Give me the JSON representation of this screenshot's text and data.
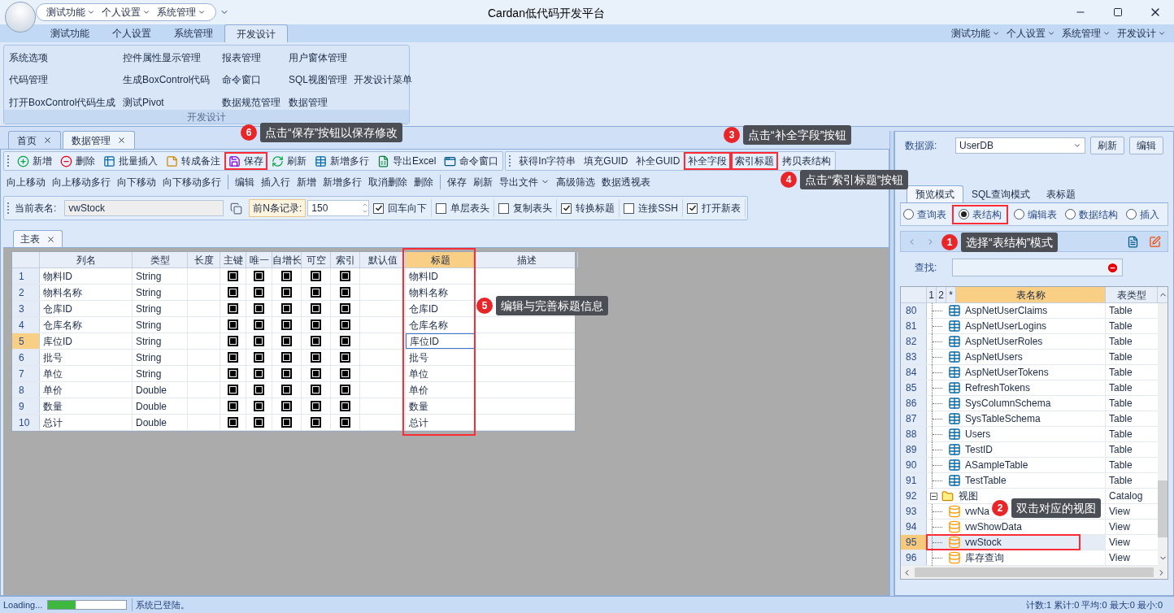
{
  "window": {
    "title": "Cardan低代码开发平台"
  },
  "quick_access": [
    "测试功能",
    "个人设置",
    "系统管理"
  ],
  "ribbon_tabs": [
    {
      "label": "测试功能",
      "selected": false
    },
    {
      "label": "个人设置",
      "selected": false
    },
    {
      "label": "系统管理",
      "selected": false
    },
    {
      "label": "开发设计",
      "selected": true
    }
  ],
  "header_menus": [
    "测试功能",
    "个人设置",
    "系统管理",
    "开发设计"
  ],
  "ribbon_group": {
    "title": "开发设计",
    "rows": [
      [
        "系统选项",
        "控件属性显示管理",
        "报表管理",
        "用户窗体管理"
      ],
      [
        "代码管理",
        "生成BoxControl代码",
        "命令窗口",
        "SQL视图管理",
        "开发设计菜单"
      ],
      [
        "打开BoxControl代码生成",
        "测试Pivot",
        "数据规范管理",
        "数据管理"
      ]
    ]
  },
  "document_tabs": [
    {
      "label": "首页",
      "selected": false
    },
    {
      "label": "数据管理",
      "selected": true
    }
  ],
  "toolbar_1": [
    [
      {
        "label": "新增",
        "kind": "add",
        "highlighted": false
      },
      {
        "label": "删除",
        "kind": "delete",
        "highlighted": false
      },
      {
        "label": "批量插入",
        "kind": "batch",
        "highlighted": false
      },
      {
        "label": "转成备注",
        "kind": "note",
        "highlighted": false
      },
      {
        "label": "保存",
        "kind": "save",
        "highlighted": true
      },
      {
        "label": "刷新",
        "kind": "refresh",
        "highlighted": false
      },
      {
        "label": "新增多行",
        "kind": "addrows",
        "highlighted": false
      },
      {
        "label": "导出Excel",
        "kind": "excel",
        "highlighted": false
      },
      {
        "label": "命令窗口",
        "kind": "window",
        "highlighted": false
      }
    ],
    [
      {
        "label": "获得In字符串",
        "kind": "text",
        "highlighted": false
      },
      {
        "label": "填充GUID",
        "kind": "text",
        "highlighted": false
      },
      {
        "label": "补全GUID",
        "kind": "text",
        "highlighted": false
      },
      {
        "label": "补全字段",
        "kind": "text",
        "highlighted": true
      },
      {
        "label": "索引标题",
        "kind": "text",
        "highlighted": true
      },
      {
        "label": "拷贝表结构",
        "kind": "text",
        "highlighted": false
      }
    ]
  ],
  "toolbar_2": [
    [
      {
        "label": "向上移动",
        "dropdown": false
      },
      {
        "label": "向上移动多行",
        "dropdown": false
      },
      {
        "label": "向下移动",
        "dropdown": false
      },
      {
        "label": "向下移动多行",
        "dropdown": false
      }
    ],
    [
      {
        "label": "编辑",
        "dropdown": false
      },
      {
        "label": "插入行",
        "dropdown": false
      },
      {
        "label": "新增",
        "dropdown": false
      },
      {
        "label": "新增多行",
        "dropdown": false
      },
      {
        "label": "取消删除",
        "dropdown": false
      },
      {
        "label": "删除",
        "dropdown": false
      }
    ],
    [
      {
        "label": "保存",
        "dropdown": false
      },
      {
        "label": "刷新",
        "dropdown": false
      },
      {
        "label": "导出文件",
        "dropdown": true
      },
      {
        "label": "高级筛选",
        "dropdown": false
      },
      {
        "label": "数据透视表",
        "dropdown": false
      }
    ]
  ],
  "table_bar": {
    "label": "当前表名:",
    "value": "vwStock",
    "top_n_label": "前N条记录:",
    "top_n": "150",
    "options": [
      {
        "label": "回车向下",
        "checked": true
      },
      {
        "label": "单层表头",
        "checked": false
      },
      {
        "label": "复制表头",
        "checked": false
      },
      {
        "label": "转换标题",
        "checked": true
      },
      {
        "label": "连接SSH",
        "checked": false
      },
      {
        "label": "打开新表",
        "checked": true
      }
    ]
  },
  "sub_tabs": [
    {
      "label": "主表",
      "selected": true
    }
  ],
  "grid": {
    "columns": [
      {
        "label": "列名",
        "selected": false,
        "highlighted": false
      },
      {
        "label": "类型",
        "selected": false,
        "highlighted": false
      },
      {
        "label": "长度",
        "selected": false,
        "highlighted": false
      },
      {
        "label": "主键",
        "selected": false,
        "highlighted": false
      },
      {
        "label": "唯一",
        "selected": false,
        "highlighted": false
      },
      {
        "label": "自增长",
        "selected": false,
        "highlighted": false
      },
      {
        "label": "可空",
        "selected": false,
        "highlighted": false
      },
      {
        "label": "索引",
        "selected": false,
        "highlighted": false
      },
      {
        "label": "默认值",
        "selected": false,
        "highlighted": false
      },
      {
        "label": "标题",
        "selected": true,
        "highlighted": true
      },
      {
        "label": "描述",
        "selected": false,
        "highlighted": false
      }
    ],
    "rows": [
      {
        "num": "1",
        "name": "物料ID",
        "type": "String",
        "flags": [
          true,
          true,
          true,
          true,
          true
        ],
        "title": "物料ID",
        "selected": false
      },
      {
        "num": "2",
        "name": "物料名称",
        "type": "String",
        "flags": [
          true,
          true,
          true,
          true,
          true
        ],
        "title": "物料名称",
        "selected": false
      },
      {
        "num": "3",
        "name": "仓库ID",
        "type": "String",
        "flags": [
          true,
          true,
          true,
          true,
          true
        ],
        "title": "仓库ID",
        "selected": false
      },
      {
        "num": "4",
        "name": "仓库名称",
        "type": "String",
        "flags": [
          true,
          true,
          true,
          true,
          true
        ],
        "title": "仓库名称",
        "selected": false
      },
      {
        "num": "5",
        "name": "库位ID",
        "type": "String",
        "flags": [
          true,
          true,
          true,
          true,
          true
        ],
        "title": "库位ID",
        "selected": true
      },
      {
        "num": "6",
        "name": "批号",
        "type": "String",
        "flags": [
          true,
          true,
          true,
          true,
          true
        ],
        "title": "批号",
        "selected": false
      },
      {
        "num": "7",
        "name": "单位",
        "type": "String",
        "flags": [
          true,
          true,
          true,
          true,
          true
        ],
        "title": "单位",
        "selected": false
      },
      {
        "num": "8",
        "name": "单价",
        "type": "Double",
        "flags": [
          true,
          true,
          true,
          true,
          true
        ],
        "title": "单价",
        "selected": false
      },
      {
        "num": "9",
        "name": "数量",
        "type": "Double",
        "flags": [
          true,
          true,
          true,
          true,
          true
        ],
        "title": "数量",
        "selected": false
      },
      {
        "num": "10",
        "name": "总计",
        "type": "Double",
        "flags": [
          true,
          true,
          true,
          true,
          true
        ],
        "title": "总计",
        "selected": false
      }
    ]
  },
  "right_panel": {
    "datasource_label": "数据源:",
    "datasource": "UserDB",
    "buttons": [
      "刷新",
      "编辑"
    ],
    "tabs": [
      {
        "label": "预览模式",
        "selected": true
      },
      {
        "label": "SQL查询模式",
        "selected": false
      },
      {
        "label": "表标题",
        "selected": false
      }
    ],
    "modes": [
      {
        "label": "查询表",
        "selected": false,
        "highlighted": false
      },
      {
        "label": "表结构",
        "selected": true,
        "highlighted": true
      },
      {
        "label": "编辑表",
        "selected": false,
        "highlighted": false
      },
      {
        "label": "数据结构",
        "selected": false,
        "highlighted": false
      },
      {
        "label": "插入",
        "selected": false,
        "highlighted": false
      }
    ],
    "search_label": "查找:",
    "tree": {
      "columns": [
        {
          "label": "1",
          "selected": false
        },
        {
          "label": "2",
          "selected": false
        },
        {
          "label": "*",
          "selected": false
        },
        {
          "label": "表名称",
          "selected": true
        },
        {
          "label": "表类型",
          "selected": false
        }
      ],
      "items": [
        {
          "num": "80",
          "name": "AspNetUserClaims",
          "type": "Table",
          "kind": "table",
          "selected": false,
          "highlighted": false
        },
        {
          "num": "81",
          "name": "AspNetUserLogins",
          "type": "Table",
          "kind": "table",
          "selected": false,
          "highlighted": false
        },
        {
          "num": "82",
          "name": "AspNetUserRoles",
          "type": "Table",
          "kind": "table",
          "selected": false,
          "highlighted": false
        },
        {
          "num": "83",
          "name": "AspNetUsers",
          "type": "Table",
          "kind": "table",
          "selected": false,
          "highlighted": false
        },
        {
          "num": "84",
          "name": "AspNetUserTokens",
          "type": "Table",
          "kind": "table",
          "selected": false,
          "highlighted": false
        },
        {
          "num": "85",
          "name": "RefreshTokens",
          "type": "Table",
          "kind": "table",
          "selected": false,
          "highlighted": false
        },
        {
          "num": "86",
          "name": "SysColumnSchema",
          "type": "Table",
          "kind": "table",
          "selected": false,
          "highlighted": false
        },
        {
          "num": "87",
          "name": "SysTableSchema",
          "type": "Table",
          "kind": "table",
          "selected": false,
          "highlighted": false
        },
        {
          "num": "88",
          "name": "Users",
          "type": "Table",
          "kind": "table",
          "selected": false,
          "highlighted": false
        },
        {
          "num": "89",
          "name": "TestID",
          "type": "Table",
          "kind": "table",
          "selected": false,
          "highlighted": false
        },
        {
          "num": "90",
          "name": "ASampleTable",
          "type": "Table",
          "kind": "table",
          "selected": false,
          "highlighted": false
        },
        {
          "num": "91",
          "name": "TestTable",
          "type": "Table",
          "kind": "table",
          "selected": false,
          "highlighted": false
        },
        {
          "num": "92",
          "name": "视图",
          "type": "Catalog",
          "kind": "catalog",
          "expanded": true,
          "selected": false,
          "highlighted": false,
          "children": [
            {
              "num": "93",
              "name": "vwNa",
              "type": "View",
              "kind": "view",
              "selected": false,
              "highlighted": false
            },
            {
              "num": "94",
              "name": "vwShowData",
              "type": "View",
              "kind": "view",
              "selected": false,
              "highlighted": false
            },
            {
              "num": "95",
              "name": "vwStock",
              "type": "View",
              "kind": "view",
              "selected": true,
              "highlighted": true
            },
            {
              "num": "96",
              "name": "库存查询",
              "type": "View",
              "kind": "view",
              "selected": false,
              "highlighted": false
            }
          ]
        }
      ]
    }
  },
  "annotations": [
    {
      "number": "1",
      "text": "选择“表结构”模式"
    },
    {
      "number": "2",
      "text": "双击对应的视图"
    },
    {
      "number": "3",
      "text": "点击“补全字段”按钮"
    },
    {
      "number": "4",
      "text": "点击“索引标题”按钮"
    },
    {
      "number": "5",
      "text": "编辑与完善标题信息"
    },
    {
      "number": "6",
      "text": "点击“保存”按钮以保存修改"
    }
  ],
  "status_bar": {
    "loading": "Loading...",
    "level": 0.35,
    "message": "系统已登陆。",
    "summary": "计数:1 累计:0 平均:0 最大:0 最小:0"
  }
}
